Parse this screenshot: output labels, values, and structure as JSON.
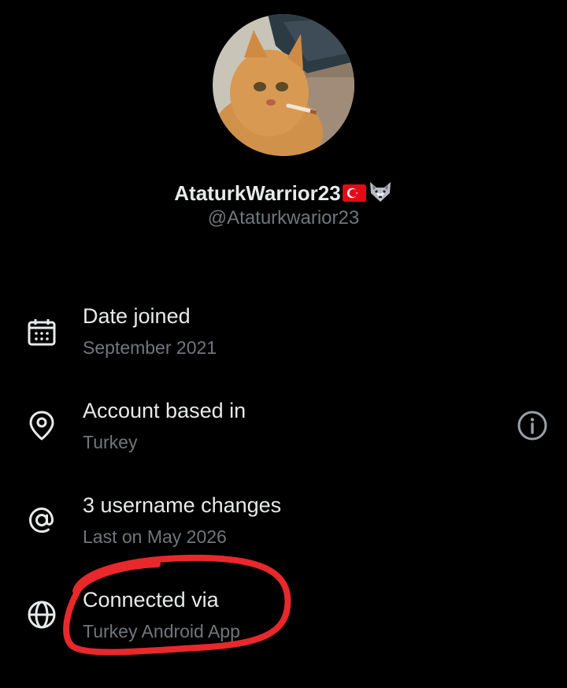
{
  "profile": {
    "display_name": "AtaturkWarrior23",
    "handle": "@Ataturkwarior23",
    "badges": [
      "turkey-flag",
      "wolf-face"
    ]
  },
  "info_rows": [
    {
      "icon": "calendar-icon",
      "title": "Date joined",
      "subtitle": "September 2021"
    },
    {
      "icon": "location-pin-icon",
      "title": "Account based in",
      "subtitle": "Turkey"
    },
    {
      "icon": "at-sign-icon",
      "title": "3 username changes",
      "subtitle": "Last on May 2026"
    },
    {
      "icon": "globe-icon",
      "title": "Connected via",
      "subtitle": "Turkey Android App"
    }
  ],
  "colors": {
    "background": "#000000",
    "primary_text": "#e7e9ea",
    "secondary_text": "#71767b",
    "annotation": "#e8282b",
    "flag_red": "#e30a17"
  }
}
